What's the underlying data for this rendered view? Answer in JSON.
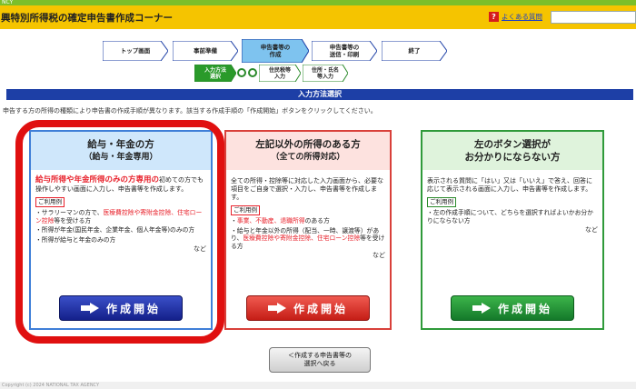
{
  "top_strip": {
    "text": "NCY"
  },
  "header": {
    "title": "興特別所得税の確定申告書作成コーナー",
    "faq_icon": "?",
    "faq_label": "よくある質問",
    "search_placeholder": ""
  },
  "steps": [
    {
      "label": "トップ画面",
      "active": false
    },
    {
      "label": "事前準備",
      "active": false
    },
    {
      "label": "申告書等の\n作成",
      "active": true
    },
    {
      "label": "申告書等の\n送信・印刷",
      "active": false
    },
    {
      "label": "終了",
      "active": false
    }
  ],
  "substeps": [
    {
      "label": "入力方法\n選択",
      "active": true
    },
    {
      "label": "住民税等\n入力",
      "active": false
    },
    {
      "label": "住所・氏名\n等入力",
      "active": false
    }
  ],
  "section_title": "入力方法選択",
  "instruction": "申告する方の所得の種類により申告書の作成手順が異なります。該当する作成手順の「作成開始」ボタンをクリックしてください。",
  "cards": [
    {
      "title": "給与・年金の方",
      "subtitle": "（給与・年金専用）",
      "lead_red": "給与所得や年金所得のみの方専用の",
      "lead_rest": "初めての方でも操作しやすい画面に入力し、申告書等を作成します。",
      "usage_label": "ご利用例",
      "items": [
        {
          "pre": "・サラリーマンの方で、",
          "red": "医療費控除や寄附金控除、住宅ローン控除",
          "post": "等を受ける方"
        },
        {
          "pre": "・所得が年金(国民年金、企業年金、個人年金等)のみの方",
          "red": "",
          "post": ""
        },
        {
          "pre": "・所得が給与と年金のみの方",
          "red": "",
          "post": ""
        }
      ],
      "nado": "など",
      "button": "作成開始",
      "color": "#1a2b9e"
    },
    {
      "title": "左記以外の所得のある方",
      "subtitle": "（全ての所得対応）",
      "lead": "全ての所得・控除等に対応した入力画面から、必要な項目をご自身で選択・入力し、申告書等を作成します。",
      "usage_label": "ご利用例",
      "items": [
        {
          "pre": "・",
          "red": "事業、不動産、退職所得",
          "post": "のある方"
        },
        {
          "pre": "・給与と年金以外の所得（配当、一時、譲渡等）があり、",
          "red": "医療費控除や寄附金控除、住宅ローン控除",
          "post": "等を受ける方"
        }
      ],
      "nado": "など",
      "button": "作成開始",
      "color": "#d0251f"
    },
    {
      "title": "左のボタン選択が",
      "subtitle": "お分かりにならない方",
      "lead": "表示される質問に「はい」又は「いいえ」で答え、回答に応じて表示される画面に入力し、申告書等を作成します。",
      "usage_label": "ご利用例",
      "items": [
        {
          "pre": "・左の作成手順について、どちらを選択すればよいかお分かりにならない方",
          "red": "",
          "post": ""
        }
      ],
      "nado": "など",
      "button": "作成開始",
      "color": "#1f8a2c"
    }
  ],
  "back_button": "＜作成する申告書等の\n選択へ戻る",
  "footer": "Copyright (c) 2024 NATIONAL TAX AGENCY"
}
